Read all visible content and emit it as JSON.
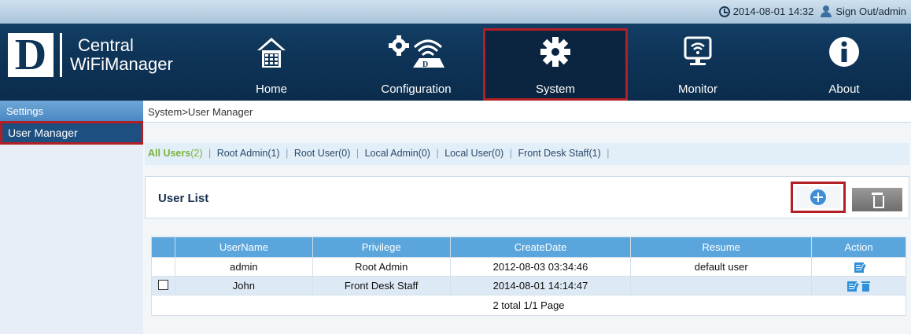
{
  "header": {
    "datetime": "2014-08-01 14:32",
    "signout": "Sign Out/admin",
    "logo_letter": "D",
    "logo_line1": "Central",
    "logo_line2": "WiFiManager"
  },
  "nav": [
    {
      "label": "Home",
      "icon": "home-icon"
    },
    {
      "label": "Configuration",
      "icon": "configuration-icon"
    },
    {
      "label": "System",
      "icon": "gear-icon",
      "active": true
    },
    {
      "label": "Monitor",
      "icon": "monitor-icon"
    },
    {
      "label": "About",
      "icon": "info-icon"
    }
  ],
  "sidebar": {
    "section": "Settings",
    "items": [
      {
        "label": "User Manager",
        "active": true
      }
    ]
  },
  "breadcrumb": "System>User Manager",
  "filters": {
    "all": "All Users",
    "all_count": "(2)",
    "root_admin": "Root Admin(1)",
    "root_user": "Root User(0)",
    "local_admin": "Local Admin(0)",
    "local_user": "Local User(0)",
    "front_desk": "Front Desk Staff(1)"
  },
  "panel": {
    "title": "User List"
  },
  "table": {
    "columns": [
      "UserName",
      "Privilege",
      "CreateDate",
      "Resume",
      "Action"
    ],
    "rows": [
      {
        "username": "admin",
        "privilege": "Root Admin",
        "create_date": "2012-08-03 03:34:46",
        "resume": "default user"
      },
      {
        "username": "John",
        "privilege": "Front Desk Staff",
        "create_date": "2014-08-01 14:14:47",
        "resume": ""
      }
    ],
    "footer": "2 total 1/1 Page"
  },
  "colors": {
    "header_bg": "#0e3458",
    "highlight_outline": "#b21f24",
    "table_header": "#5aa6dc",
    "active_filter": "#7bb33d"
  }
}
